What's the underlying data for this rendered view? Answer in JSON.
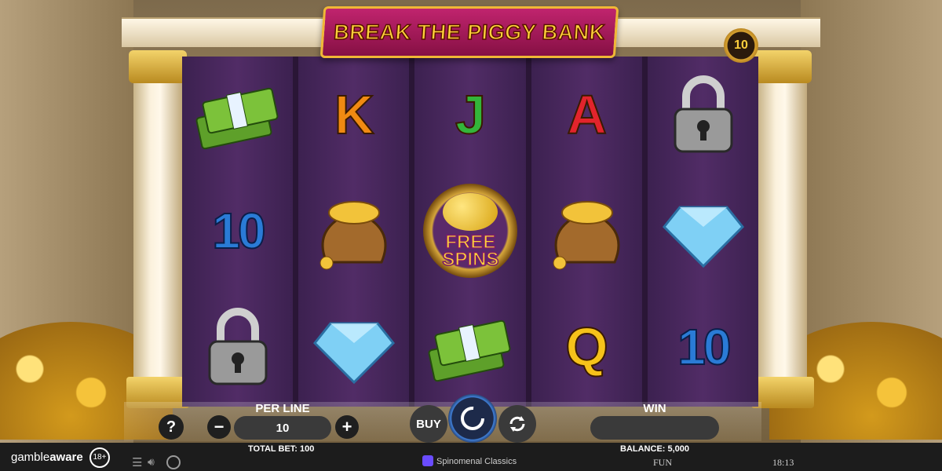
{
  "game": {
    "title": "BREAK THE PIGGY BANK",
    "paylines": "10"
  },
  "reels": [
    [
      "cash-stack",
      "10",
      "padlock"
    ],
    [
      "K",
      "coin-bag",
      "diamond"
    ],
    [
      "J",
      "piggy-bank-free-spins",
      "cash-stack"
    ],
    [
      "A",
      "coin-bag",
      "Q"
    ],
    [
      "padlock",
      "diamond",
      "10"
    ]
  ],
  "free_spins_text": [
    "FREE",
    "SPINS"
  ],
  "letter_colors": {
    "K": "#f08a12",
    "J": "#33b53a",
    "A": "#e2242c",
    "Q": "#f6c21a"
  },
  "controls": {
    "help_label": "?",
    "per_line_label": "PER LINE",
    "minus_label": "−",
    "bet_value": "10",
    "plus_label": "+",
    "total_bet": "TOTAL BET: 100",
    "buy_label": "BUY",
    "win_label": "WIN",
    "win_value": "",
    "balance": "BALANCE: 5,000"
  },
  "footer": {
    "gambleaware_prefix": "gamble",
    "gambleaware_suffix": "aware",
    "age_badge": "18+",
    "provider": "Spinomenal Classics",
    "mode": "FUN",
    "time": "18:13"
  }
}
